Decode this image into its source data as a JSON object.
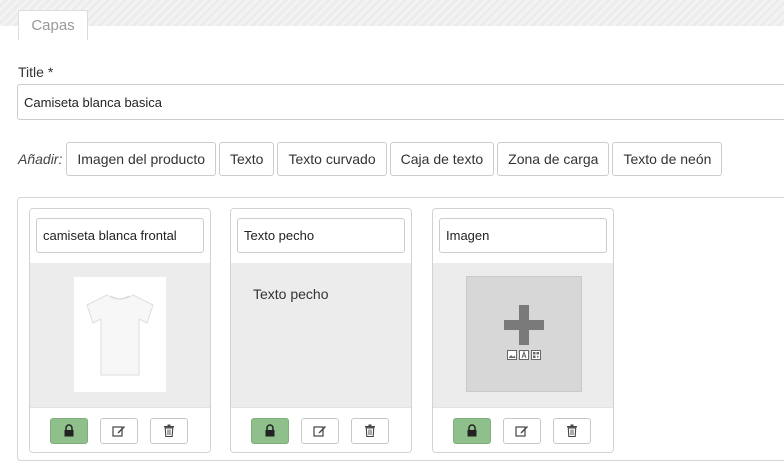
{
  "tab": {
    "label": "Capas"
  },
  "title_field": {
    "label": "Title *",
    "value": "Camiseta blanca basica"
  },
  "add_bar": {
    "label": "Añadir:",
    "buttons": [
      {
        "label": "Imagen del producto"
      },
      {
        "label": "Texto"
      },
      {
        "label": "Texto curvado"
      },
      {
        "label": "Caja de texto"
      },
      {
        "label": "Zona de carga"
      },
      {
        "label": "Texto de neón"
      }
    ]
  },
  "layers": [
    {
      "name": "camiseta blanca frontal",
      "type": "product-image",
      "locked": true
    },
    {
      "name": "Texto pecho",
      "type": "text",
      "preview_text": "Texto pecho",
      "locked": true
    },
    {
      "name": "Imagen",
      "type": "image-upload",
      "locked": true
    }
  ],
  "colors": {
    "lock_button": "#8fbf8b",
    "card_body": "#ececec",
    "placeholder": "#d7d7d7",
    "plus_icon": "#7a7a7a"
  }
}
